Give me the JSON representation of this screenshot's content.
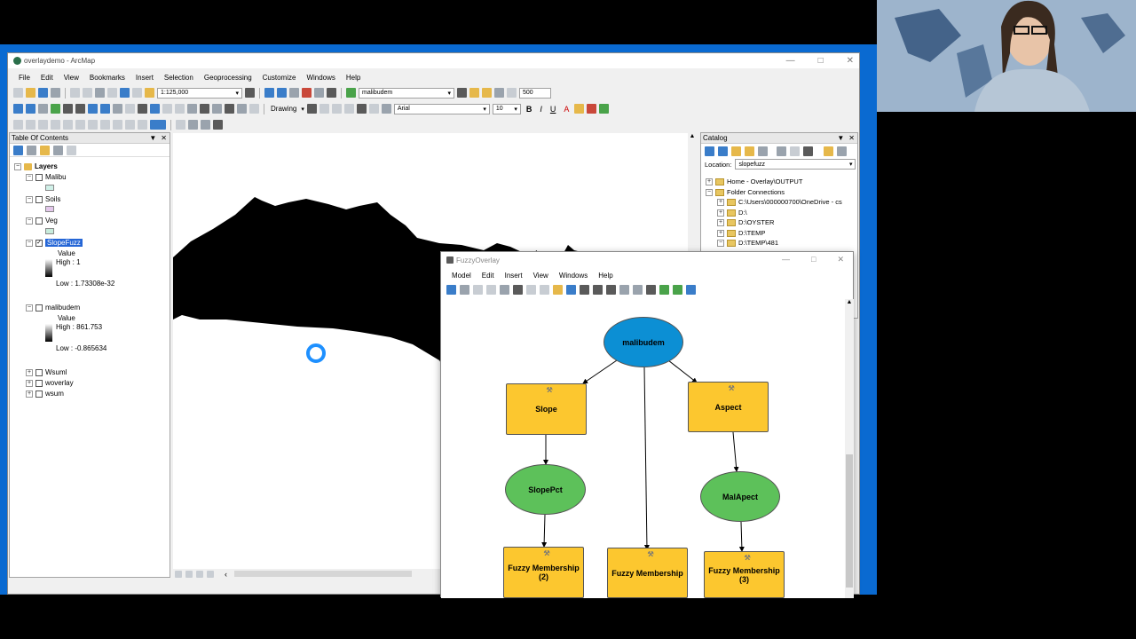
{
  "window": {
    "title": "overlaydemo - ArcMap"
  },
  "menu": [
    "File",
    "Edit",
    "View",
    "Bookmarks",
    "Insert",
    "Selection",
    "Geoprocessing",
    "Customize",
    "Windows",
    "Help"
  ],
  "toolbar": {
    "scale": "1:125,000",
    "layer": "malibudem",
    "number": "500",
    "drawing": "Drawing",
    "font": "Arial",
    "size": "10"
  },
  "toc": {
    "title": "Table Of Contents",
    "root": "Layers",
    "layers": [
      {
        "name": "Malibu"
      },
      {
        "name": "Soils"
      },
      {
        "name": "Veg"
      },
      {
        "name": "SlopeFuzz",
        "value_label": "Value",
        "high": "High : 1",
        "low": "Low : 1.73308e-32"
      },
      {
        "name": "malibudem",
        "value_label": "Value",
        "high": "High : 861.753",
        "low": "Low : -0.865634"
      },
      {
        "name": "Wsuml"
      },
      {
        "name": "woverlay"
      },
      {
        "name": "wsum"
      }
    ]
  },
  "catalog": {
    "title": "Catalog",
    "location_label": "Location:",
    "location_value": "slopefuzz",
    "items": [
      "Home - Overlay\\OUTPUT",
      "Folder Connections",
      "C:\\Users\\000000700\\OneDrive - cs",
      "D:\\",
      "D:\\OYSTER",
      "D:\\TEMP",
      "D:\\TEMP\\481"
    ]
  },
  "model": {
    "title": "FuzzyOverlay",
    "menu": [
      "Model",
      "Edit",
      "Insert",
      "View",
      "Windows",
      "Help"
    ],
    "nodes": {
      "malibudem": "malibudem",
      "slope": "Slope",
      "aspect": "Aspect",
      "slopepct": "SlopePct",
      "malapect": "MalApect",
      "fm2": "Fuzzy Membership (2)",
      "fm": "Fuzzy Membership",
      "fm3": "Fuzzy Membership (3)"
    }
  },
  "colors": {
    "blue_node": "#0c8fd4",
    "green_node": "#5dc15a",
    "yellow_node": "#fcc72f",
    "desktop": "#0a6ad1"
  }
}
